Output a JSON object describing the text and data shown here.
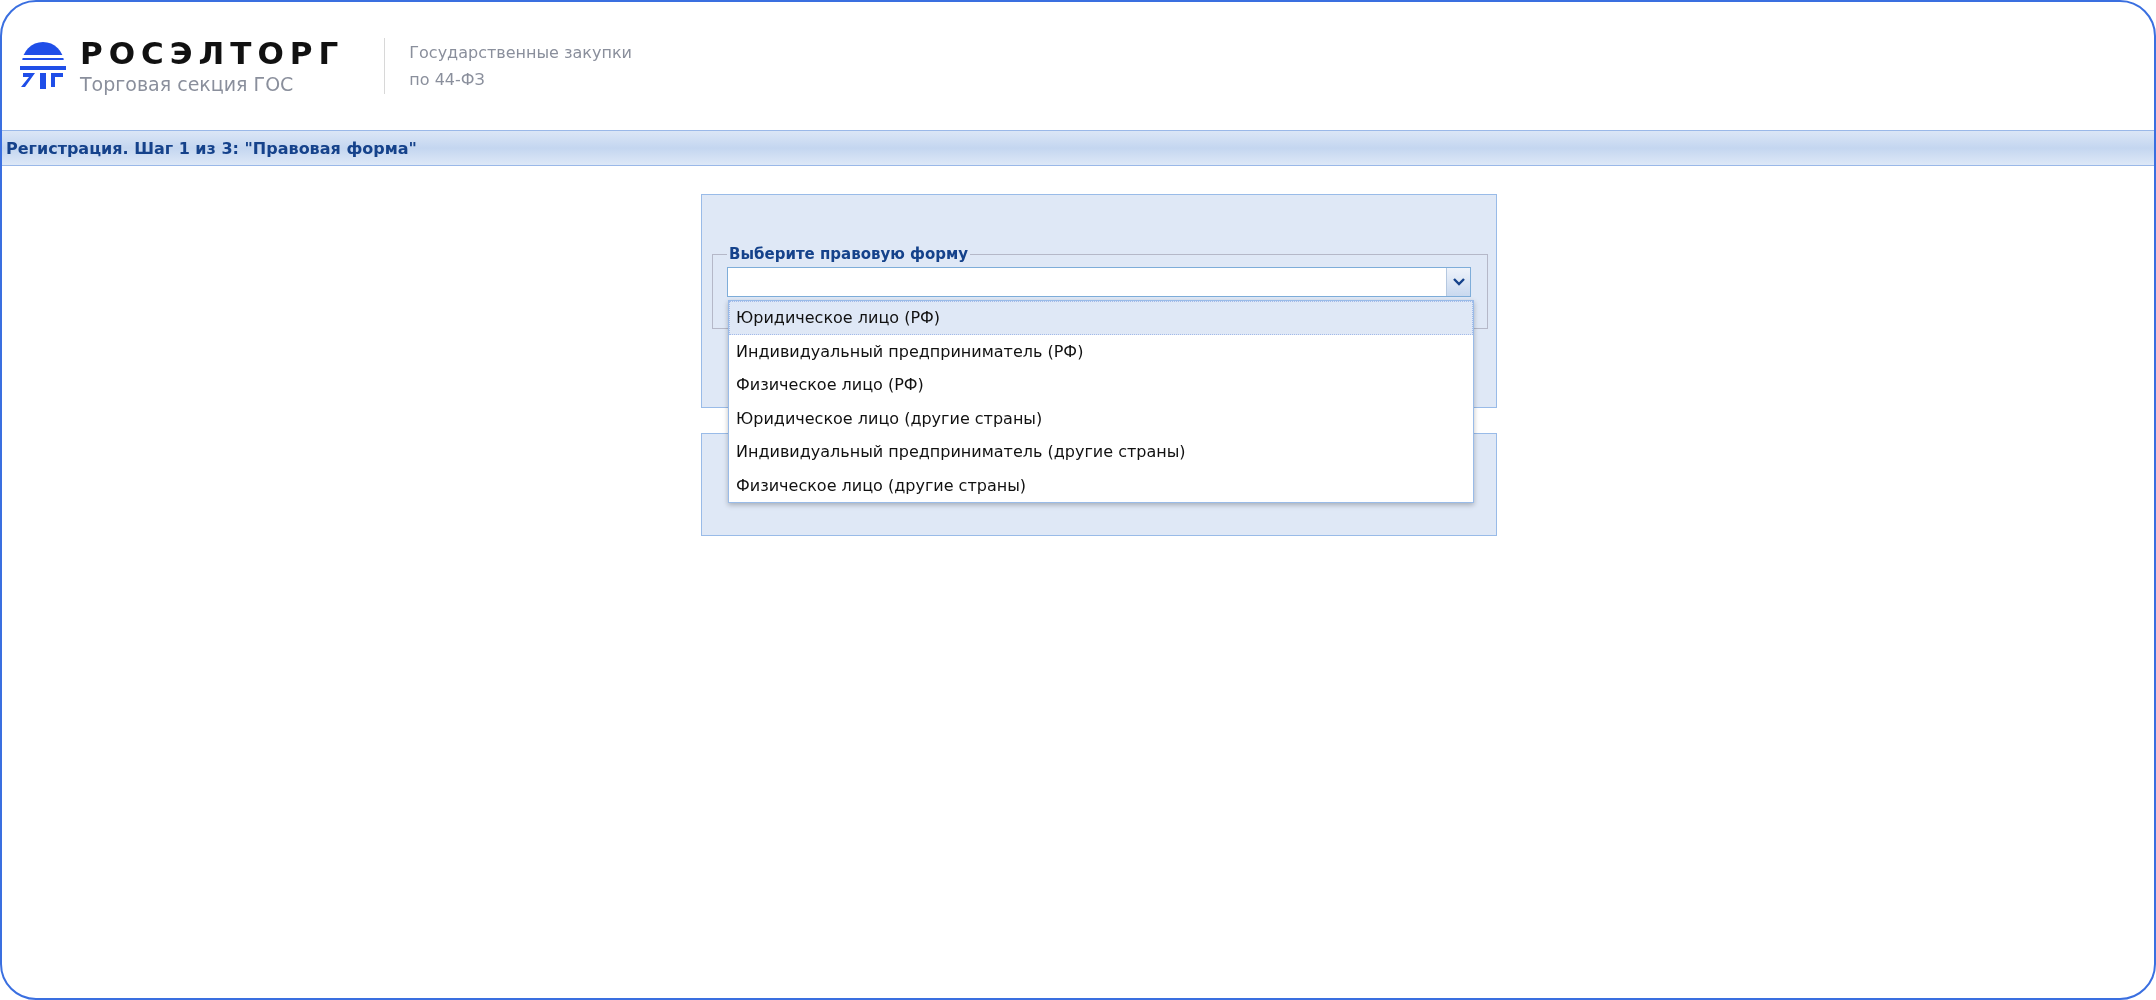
{
  "header": {
    "logo_text": "РОСЭЛТОРГ",
    "logo_subtitle": "Торговая секция ГОС",
    "section_lines": [
      "Государственные закупки",
      "по 44-ФЗ"
    ]
  },
  "title_bar": {
    "title": "Регистрация. Шаг 1 из 3: \"Правовая форма\""
  },
  "form": {
    "legend": "Выберите правовую форму",
    "dropdown": {
      "expanded": true,
      "options": [
        {
          "label": "Юридическое лицо (РФ)",
          "selected": true
        },
        {
          "label": "Индивидуальный предприниматель (РФ)",
          "selected": false
        },
        {
          "label": "Физическое лицо (РФ)",
          "selected": false
        },
        {
          "label": "Юридическое лицо (другие страны)",
          "selected": false
        },
        {
          "label": "Индивидуальный предприниматель (другие страны)",
          "selected": false
        },
        {
          "label": "Физическое лицо (другие страны)",
          "selected": false
        }
      ]
    }
  }
}
